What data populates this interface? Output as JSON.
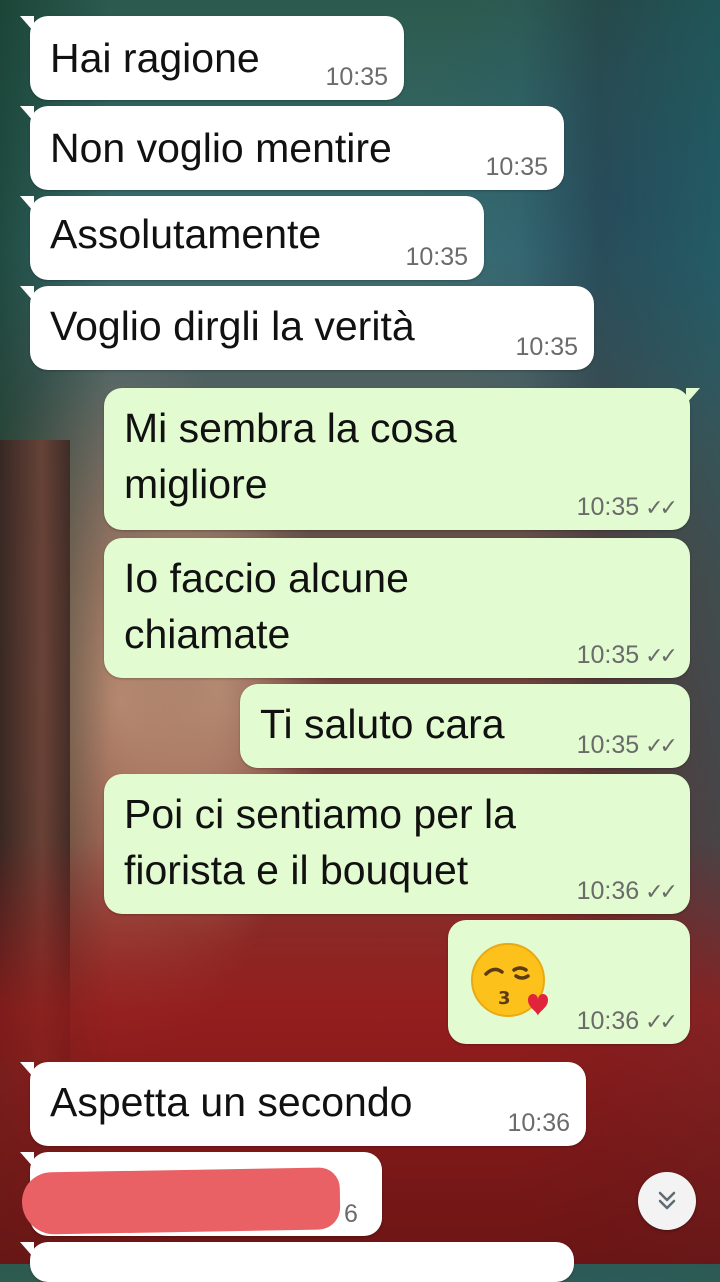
{
  "messages": [
    {
      "dir": "in",
      "text": "Hai ragione",
      "time": "10:35"
    },
    {
      "dir": "in",
      "text": "Non voglio mentire",
      "time": "10:35"
    },
    {
      "dir": "in",
      "text": "Assolutamente",
      "time": "10:35"
    },
    {
      "dir": "in",
      "text": "Voglio dirgli la verità",
      "time": "10:35"
    },
    {
      "dir": "out",
      "text": "Mi sembra la cosa\nmigliore",
      "time": "10:35",
      "status": "read"
    },
    {
      "dir": "out",
      "text": "Io faccio alcune\nchiamate",
      "time": "10:35",
      "status": "read"
    },
    {
      "dir": "out",
      "text": "Ti saluto cara",
      "time": "10:35",
      "status": "read"
    },
    {
      "dir": "out",
      "text": "Poi ci sentiamo per la\nfiorista e il bouquet",
      "time": "10:36",
      "status": "read"
    },
    {
      "dir": "out",
      "emoji": "kissing-face-with-heart",
      "time": "10:36",
      "status": "read"
    },
    {
      "dir": "in",
      "text": "Aspetta un secondo",
      "time": "10:36"
    },
    {
      "dir": "in",
      "text": "",
      "time": "6",
      "redacted": true
    }
  ],
  "ticks": "✓✓",
  "scroll_button": {
    "icon": "double-chevron-down-icon"
  },
  "colors": {
    "incoming": "#ffffff",
    "outgoing": "#e2fbd0",
    "redaction": "#e96164",
    "time": "#6b6b6b"
  }
}
